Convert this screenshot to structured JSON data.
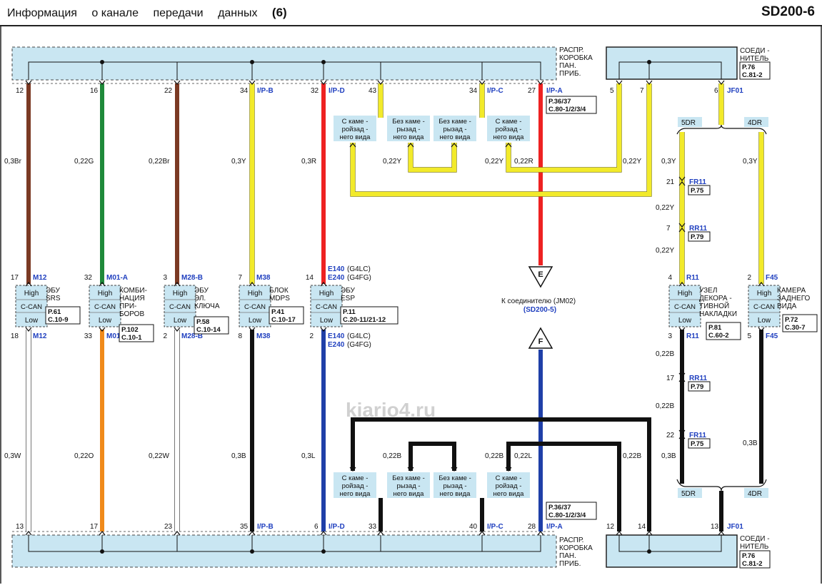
{
  "header": {
    "title_words": [
      "Информация",
      "о канале",
      "передачи",
      "данных"
    ],
    "title_num": "(6)",
    "code": "SD200-6"
  },
  "colors": {
    "panel": "#c9e6f2",
    "frame": "#222222",
    "blue_text": "#1f3fbf",
    "wire_brown": "#7b3a24",
    "wire_green": "#1f8a3a",
    "wire_yellow": "#f2ea2a",
    "wire_red": "#ee2222",
    "wire_white": "#ffffff",
    "wire_orange": "#f08a1a",
    "wire_black": "#111111",
    "wire_dblue": "#1f3fa8"
  },
  "top_box": {
    "label_lines": [
      "РАСПР.",
      "КОРОБКА",
      "ПАН.",
      "ПРИБ."
    ],
    "pins": [
      "12",
      "16",
      "22",
      "34",
      "32",
      "43",
      "34",
      "27"
    ],
    "tags": [
      "I/P-B",
      "I/P-D",
      "I/P-C",
      "I/P-A"
    ],
    "ref_lines": [
      "P.36/37",
      "C.80-1/2/3/4"
    ]
  },
  "top_conn": {
    "label_lines": [
      "СОЕДИ -",
      "НИТЕЛЬ"
    ],
    "ref_lines": [
      "P.76",
      "C.81-2"
    ],
    "pins": [
      "5",
      "7",
      "6"
    ],
    "tag": "JF01"
  },
  "bottom_box": {
    "label_lines": [
      "РАСПР.",
      "КОРОБКА",
      "ПАН.",
      "ПРИБ."
    ],
    "pins": [
      "13",
      "17",
      "23",
      "35",
      "6",
      "33",
      "40",
      "28"
    ],
    "tags": [
      "I/P-B",
      "I/P-D",
      "I/P-C",
      "I/P-A"
    ],
    "ref_lines": [
      "P.36/37",
      "C.80-1/2/3/4"
    ]
  },
  "bottom_conn": {
    "label_lines": [
      "СОЕДИ -",
      "НИТЕЛЬ"
    ],
    "ref_lines": [
      "P.76",
      "C.81-2"
    ],
    "pins": [
      "12",
      "14",
      "13"
    ],
    "tag": "JF01"
  },
  "camera_options": {
    "with": [
      "С каме -",
      "ройзад -",
      "него вида"
    ],
    "without": [
      "Без каме -",
      "рызад -",
      "него вида"
    ]
  },
  "wires_top": [
    "0,3Br",
    "0,22G",
    "0,22Br",
    "0,3Y",
    "0,3R",
    "0,22Y",
    "0,22Y",
    "0,22R",
    "0,22Y",
    "0,3Y",
    "0,3Y",
    "0,22Y",
    "0,22Y"
  ],
  "wires_bottom": [
    "0,3W",
    "0,22O",
    "0,22W",
    "0,3B",
    "0,3L",
    "0,22B",
    "0,22B",
    "0,22L",
    "0,22B",
    "0,22B",
    "0,22B",
    "0,3B",
    "0,3B"
  ],
  "can": {
    "high": "High",
    "can": "C-CAN",
    "low": "Low"
  },
  "modules": [
    {
      "pin_top": "17",
      "tag_top": "M12",
      "pin_bot": "18",
      "tag_bot": "M12",
      "name_lines": [
        "ЭБУ",
        "SRS"
      ],
      "ref_lines": [
        "P.61",
        "C.10-9"
      ]
    },
    {
      "pin_top": "32",
      "tag_top": "M01-A",
      "pin_bot": "33",
      "tag_bot": "M01-A",
      "name_lines": [
        "КОМБИ-",
        "НАЦИЯ",
        "ПРИ-",
        "БОРОВ"
      ],
      "ref_lines": [
        "P.102",
        "C.10-1"
      ]
    },
    {
      "pin_top": "3",
      "tag_top": "M28-B",
      "pin_bot": "2",
      "tag_bot": "M28-B",
      "name_lines": [
        "ЭБУ",
        "ЭЛ.",
        "КЛЮЧА"
      ],
      "ref_lines": [
        "P.58",
        "C.10-14"
      ]
    },
    {
      "pin_top": "7",
      "tag_top": "M38",
      "pin_bot": "8",
      "tag_bot": "M38",
      "name_lines": [
        "БЛОК",
        "MDPS"
      ],
      "ref_lines": [
        "P.41",
        "C.10-17"
      ]
    },
    {
      "pin_top": "14",
      "tag_top": "E140",
      "tag_top_sub": "(G4LC)",
      "tag_top2": "E240",
      "tag_top2_sub": "(G4FG)",
      "pin_bot": "2",
      "tag_bot": "E140",
      "tag_bot_sub": "(G4LC)",
      "tag_bot2": "E240",
      "tag_bot2_sub": "(G4FG)",
      "name_lines": [
        "ЭБУ",
        "ESP"
      ],
      "ref_lines": [
        "P.11",
        "C.20-11/21-12"
      ]
    },
    {
      "pin_top": "4",
      "tag_top": "R11",
      "pin_bot": "3",
      "tag_bot": "R11",
      "name_lines": [
        "УЗЕЛ",
        "ДЕКОРА -",
        "ТИВНОЙ",
        "НАКЛАДКИ"
      ],
      "ref_lines": [
        "P.81",
        "C.60-2"
      ]
    },
    {
      "pin_top": "2",
      "tag_top": "F45",
      "pin_bot": "5",
      "tag_bot": "F45",
      "name_lines": [
        "КАМЕРА",
        "ЗАДНЕГО",
        "ВИДА"
      ],
      "ref_lines": [
        "P.72",
        "C.30-7"
      ]
    }
  ],
  "inline_connectors": [
    {
      "pin": "21",
      "tag": "FR11",
      "ref": "P.75"
    },
    {
      "pin": "7",
      "tag": "RR11",
      "ref": "P.79"
    },
    {
      "pin": "17",
      "tag": "RR11",
      "ref": "P.79"
    },
    {
      "pin": "22",
      "tag": "FR11",
      "ref": "P.75"
    }
  ],
  "door_options": [
    "5DR",
    "4DR"
  ],
  "offpage": {
    "e": "E",
    "f": "F",
    "note": "К соединителю  (JM02)",
    "ref": "(SD200-5)"
  },
  "watermark": "kiario4.ru"
}
